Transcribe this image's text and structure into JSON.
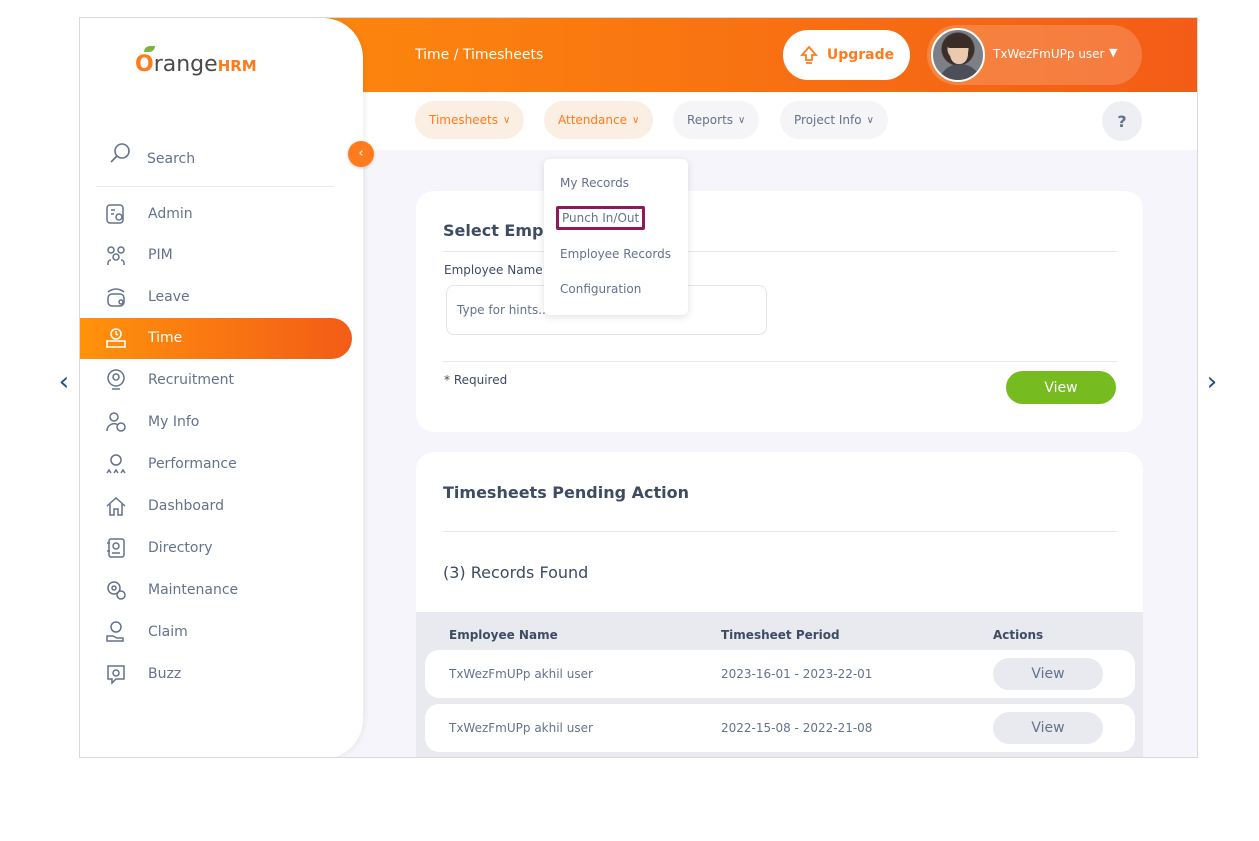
{
  "header": {
    "breadcrumb": "Time / Timesheets",
    "upgrade_label": "Upgrade",
    "user_name": "TxWezFmUPp user"
  },
  "subnav": {
    "tabs": [
      {
        "label": "Timesheets",
        "active": true
      },
      {
        "label": "Attendance",
        "active": true
      },
      {
        "label": "Reports",
        "active": false
      },
      {
        "label": "Project Info",
        "active": false
      }
    ],
    "help_label": "?"
  },
  "attendance_menu": {
    "items": [
      "My Records",
      "Punch In/Out",
      "Employee Records",
      "Configuration"
    ],
    "highlighted": "Punch In/Out"
  },
  "sidebar": {
    "brand_prefix": "O",
    "brand_name": "range",
    "brand_suffix": "HRM",
    "search_label": "Search",
    "items": [
      {
        "label": "Admin",
        "icon": "admin-icon"
      },
      {
        "label": "PIM",
        "icon": "pim-icon"
      },
      {
        "label": "Leave",
        "icon": "leave-icon"
      },
      {
        "label": "Time",
        "icon": "time-icon",
        "active": true
      },
      {
        "label": "Recruitment",
        "icon": "recruitment-icon"
      },
      {
        "label": "My Info",
        "icon": "my-info-icon"
      },
      {
        "label": "Performance",
        "icon": "performance-icon"
      },
      {
        "label": "Dashboard",
        "icon": "dashboard-icon"
      },
      {
        "label": "Directory",
        "icon": "directory-icon"
      },
      {
        "label": "Maintenance",
        "icon": "maintenance-icon"
      },
      {
        "label": "Claim",
        "icon": "claim-icon"
      },
      {
        "label": "Buzz",
        "icon": "buzz-icon"
      }
    ]
  },
  "select_employee": {
    "title": "Select Emplo",
    "field_label": "Employee Name",
    "placeholder": "Type for hints...",
    "required_note": "* Required",
    "view_label": "View"
  },
  "pending": {
    "title": "Timesheets Pending Action",
    "records_found": "(3) Records Found",
    "columns": [
      "Employee Name",
      "Timesheet Period",
      "Actions"
    ],
    "rows": [
      {
        "employee": "TxWezFmUPp akhil user",
        "period": "2023-16-01 - 2023-22-01",
        "action": "View"
      },
      {
        "employee": "TxWezFmUPp akhil user",
        "period": "2022-15-08 - 2022-21-08",
        "action": "View"
      }
    ]
  },
  "colors": {
    "brand_orange": "#ff7b1d",
    "accent_green": "#76bc21",
    "highlight_border": "#8e1a5a",
    "nav_arrow": "#1d4e89"
  }
}
